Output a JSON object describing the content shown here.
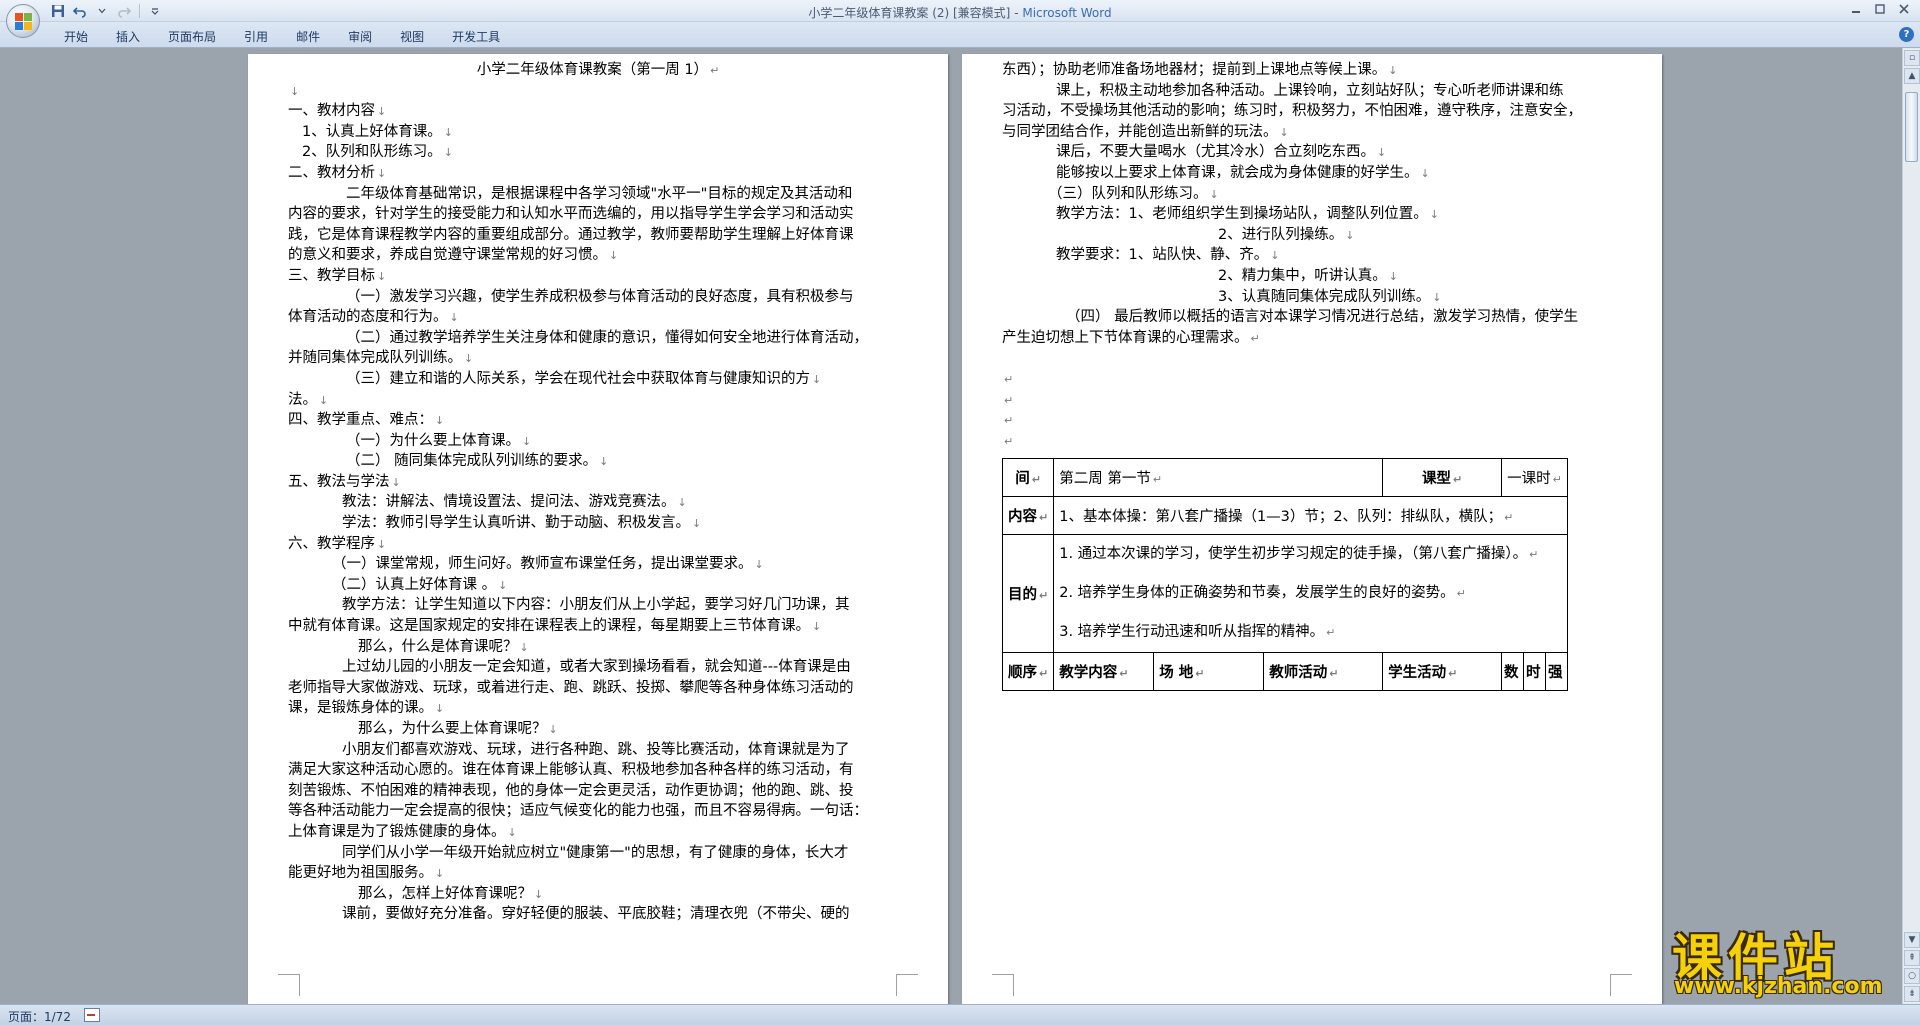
{
  "window": {
    "doc_name": "小学二年级体育课教案 (2) [兼容模式]",
    "separator": " - ",
    "app_name": "Microsoft Word"
  },
  "icons": {
    "office_button": "office-logo-icon",
    "save": "save-icon",
    "undo": "undo-icon",
    "redo": "redo-icon",
    "customize": "chevron-down-icon",
    "minimize": "minimize-icon",
    "maximize": "maximize-icon",
    "close": "close-icon",
    "help": "help-icon"
  },
  "colors": {
    "title_app": "#3b6cb3",
    "ribbon_text": "#1f3a61",
    "watermark": "#f4d10a"
  },
  "ribbon": {
    "tabs": [
      "开始",
      "插入",
      "页面布局",
      "引用",
      "邮件",
      "审阅",
      "视图",
      "开发工具"
    ],
    "help_label": "?"
  },
  "page1": {
    "title": "小学二年级体育课教案（第一周 1）",
    "lines": [
      "一、教材内容",
      "1、认真上好体育课。",
      "2、队列和队形练习。",
      "二、教材分析",
      "二年级体育基础常识，是根据课程中各学习领域\"水平一\"目标的规定及其活动和",
      "内容的要求，针对学生的接受能力和认知水平而选编的，用以指导学生学会学习和活动实",
      "践，它是体育课程教学内容的重要组成部分。通过教学，教师要帮助学生理解上好体育课",
      "的意义和要求，养成自觉遵守课堂常规的好习惯。",
      "三、教学目标",
      "（一）激发学习兴趣，使学生养成积极参与体育活动的良好态度，具有积极参与",
      "体育活动的态度和行为。",
      "（二）通过教学培养学生关注身体和健康的意识，懂得如何安全地进行体育活动，",
      "并随同集体完成队列训练。",
      "（三）建立和谐的人际关系，学会在现代社会中获取体育与健康知识的方",
      "法。",
      "四、教学重点、难点：",
      "（一）为什么要上体育课。",
      "（二）  随同集体完成队列训练的要求。",
      "五、教法与学法",
      "教法：讲解法、情境设置法、提问法、游戏竞赛法。",
      "学法：教师引导学生认真听讲、勤于动脑、积极发言。",
      "六、教学程序",
      "（一）课堂常规，师生问好。教师宣布课堂任务，提出课堂要求。",
      "（二）认真上好体育课  。",
      "教学方法：让学生知道以下内容：小朋友们从上小学起，要学习好几门功课，其",
      "中就有体育课。这是国家规定的安排在课程表上的课程，每星期要上三节体育课。",
      "那么，什么是体育课呢？",
      "上过幼儿园的小朋友一定会知道，或者大家到操场看看，就会知道---体育课是由",
      "老师指导大家做游戏、玩球，或着进行走、跑、跳跃、投掷、攀爬等各种身体练习活动的",
      "课，是锻炼身体的课。",
      "那么，为什么要上体育课呢？",
      "小朋友们都喜欢游戏、玩球，进行各种跑、跳、投等比赛活动，体育课就是为了",
      "满足大家这种活动心愿的。谁在体育课上能够认真、积极地参加各种各样的练习活动，有",
      "刻苦锻炼、不怕困难的精神表现，他的身体一定会更灵活，动作更协调；他的跑、跳、投",
      "等各种活动能力一定会提高的很快；适应气候变化的能力也强，而且不容易得病。一句话：",
      "上体育课是为了锻炼健康的身体。",
      "同学们从小学一年级开始就应树立\"健康第一\"的思想，有了健康的身体，长大才",
      "能更好地为祖国服务。",
      "那么，怎样上好体育课呢？",
      "课前，要做好充分准备。穿好轻便的服装、平底胶鞋；清理衣兜（不带尖、硬的"
    ]
  },
  "page2": {
    "lines": [
      "东西）；协助老师准备场地器材；提前到上课地点等候上课。",
      "课上，积极主动地参加各种活动。上课铃响，立刻站好队；专心听老师讲课和练",
      "习活动，不受操场其他活动的影响；练习时，积极努力，不怕困难，遵守秩序，注意安全，",
      "与同学团结合作，并能创造出新鲜的玩法。",
      "课后，不要大量喝水（尤其冷水）合立刻吃东西。",
      "能够按以上要求上体育课，就会成为身体健康的好学生。",
      "（三）队列和队形练习。",
      "教学方法：1、老师组织学生到操场站队，调整队列位置。",
      "2、进行队列操练。",
      "教学要求：1、站队快、静、齐。",
      "2、精力集中，听讲认真。",
      "3、认真随同集体完成队列训练。",
      "（四）  最后教师以概括的语言对本课学习情况进行总结，激发学习热情，使学生",
      "产生迫切想上下节体育课的心理需求。"
    ],
    "table": {
      "time_label": "间",
      "time_value": "第二周   第一节",
      "type_label": "课型",
      "type_value": "一课时",
      "content_label": "内容",
      "content_value": "1、基本体操：第八套广播操（1—3）节；2、队列：排纵队，横队；",
      "goal_label": "目的",
      "goals": [
        "1. 通过本次课的学习，使学生初步学习规定的徒手操，（第八套广播操）。",
        "2. 培养学生身体的正确姿势和节奏，发展学生的良好的姿势。",
        "3. 培养学生行动迅速和听从指挥的精神。"
      ],
      "headers": [
        "顺序",
        "教学内容",
        "场  地",
        "教师活动",
        "学生活动",
        "数",
        "时",
        "强"
      ]
    }
  },
  "statusbar": {
    "page_indicator": "页面：1/72"
  },
  "watermark": {
    "main": "课件站",
    "url": "www.kjzhan.com"
  }
}
